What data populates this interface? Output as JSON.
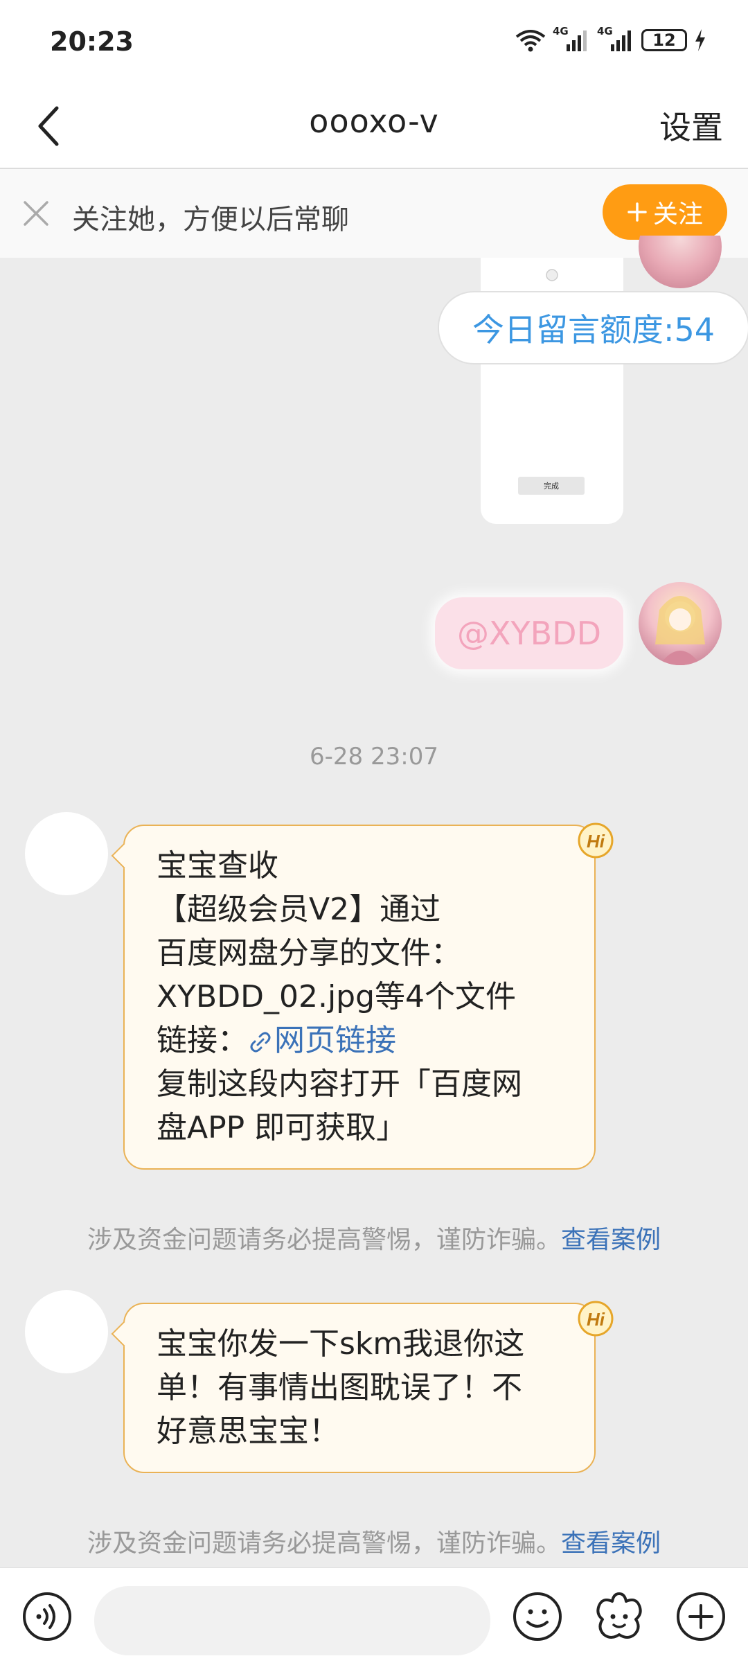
{
  "status_bar": {
    "time": "20:23",
    "battery": "12",
    "signal_1": "4G",
    "signal_2": "4G"
  },
  "nav": {
    "title": "oooxo-v",
    "settings_label": "设置"
  },
  "follow_bar": {
    "text": "关注她，方便以后常聊",
    "button_label": "关注"
  },
  "image_card": {
    "done_label": "完成"
  },
  "quota": {
    "text": "今日留言额度:54"
  },
  "my_message": {
    "text": "@XYBDD"
  },
  "timestamp": "6-28 23:07",
  "messages": [
    {
      "lines": [
        "宝宝查收",
        "【超级会员V2】通过",
        "百度网盘分享的文件：",
        "XYBDD_02.jpg等4个文件"
      ],
      "link_prefix": "链接：",
      "link_label": "网页链接",
      "lines_after": [
        "复制这段内容打开「百度网",
        "盘APP 即可获取」"
      ],
      "badge": "Hi"
    },
    {
      "lines": [
        "宝宝你发一下skm我退你这",
        "单！有事情出图耽误了！不",
        "好意思宝宝！"
      ],
      "badge": "Hi"
    }
  ],
  "notice": {
    "text": "涉及资金问题请务必提高警惕，谨防诈骗。",
    "link": "查看案例"
  },
  "bottom_bar": {
    "input_placeholder": ""
  },
  "colors": {
    "accent": "#ff9c13",
    "link": "#3b72b8",
    "quota_text": "#3c97e2",
    "bubble_border": "#eab255",
    "bubble_bg": "#fffaf0"
  },
  "icons": [
    "wifi-icon",
    "signal-icon",
    "battery-icon",
    "charging-icon",
    "back-arrow-icon",
    "close-icon",
    "plus-icon",
    "hi-badge-icon",
    "link-icon",
    "voice-icon",
    "emoji-icon",
    "sticker-icon",
    "add-icon"
  ]
}
